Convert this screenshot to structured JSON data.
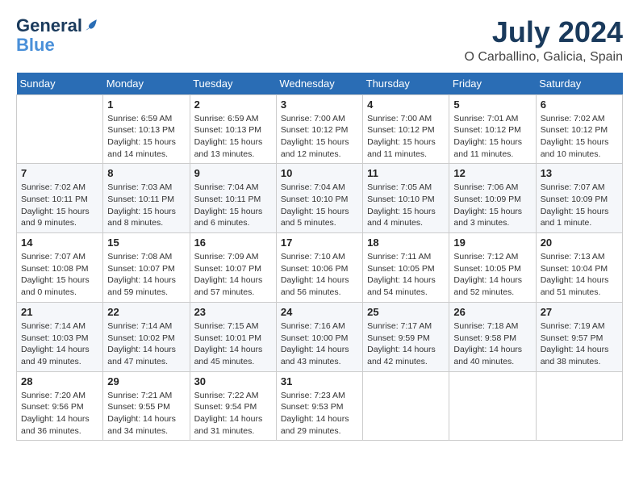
{
  "header": {
    "logo_line1": "General",
    "logo_line2": "Blue",
    "month_year": "July 2024",
    "location": "O Carballino, Galicia, Spain"
  },
  "weekdays": [
    "Sunday",
    "Monday",
    "Tuesday",
    "Wednesday",
    "Thursday",
    "Friday",
    "Saturday"
  ],
  "weeks": [
    [
      {
        "day": "",
        "info": ""
      },
      {
        "day": "1",
        "info": "Sunrise: 6:59 AM\nSunset: 10:13 PM\nDaylight: 15 hours\nand 14 minutes."
      },
      {
        "day": "2",
        "info": "Sunrise: 6:59 AM\nSunset: 10:13 PM\nDaylight: 15 hours\nand 13 minutes."
      },
      {
        "day": "3",
        "info": "Sunrise: 7:00 AM\nSunset: 10:12 PM\nDaylight: 15 hours\nand 12 minutes."
      },
      {
        "day": "4",
        "info": "Sunrise: 7:00 AM\nSunset: 10:12 PM\nDaylight: 15 hours\nand 11 minutes."
      },
      {
        "day": "5",
        "info": "Sunrise: 7:01 AM\nSunset: 10:12 PM\nDaylight: 15 hours\nand 11 minutes."
      },
      {
        "day": "6",
        "info": "Sunrise: 7:02 AM\nSunset: 10:12 PM\nDaylight: 15 hours\nand 10 minutes."
      }
    ],
    [
      {
        "day": "7",
        "info": "Sunrise: 7:02 AM\nSunset: 10:11 PM\nDaylight: 15 hours\nand 9 minutes."
      },
      {
        "day": "8",
        "info": "Sunrise: 7:03 AM\nSunset: 10:11 PM\nDaylight: 15 hours\nand 8 minutes."
      },
      {
        "day": "9",
        "info": "Sunrise: 7:04 AM\nSunset: 10:11 PM\nDaylight: 15 hours\nand 6 minutes."
      },
      {
        "day": "10",
        "info": "Sunrise: 7:04 AM\nSunset: 10:10 PM\nDaylight: 15 hours\nand 5 minutes."
      },
      {
        "day": "11",
        "info": "Sunrise: 7:05 AM\nSunset: 10:10 PM\nDaylight: 15 hours\nand 4 minutes."
      },
      {
        "day": "12",
        "info": "Sunrise: 7:06 AM\nSunset: 10:09 PM\nDaylight: 15 hours\nand 3 minutes."
      },
      {
        "day": "13",
        "info": "Sunrise: 7:07 AM\nSunset: 10:09 PM\nDaylight: 15 hours\nand 1 minute."
      }
    ],
    [
      {
        "day": "14",
        "info": "Sunrise: 7:07 AM\nSunset: 10:08 PM\nDaylight: 15 hours\nand 0 minutes."
      },
      {
        "day": "15",
        "info": "Sunrise: 7:08 AM\nSunset: 10:07 PM\nDaylight: 14 hours\nand 59 minutes."
      },
      {
        "day": "16",
        "info": "Sunrise: 7:09 AM\nSunset: 10:07 PM\nDaylight: 14 hours\nand 57 minutes."
      },
      {
        "day": "17",
        "info": "Sunrise: 7:10 AM\nSunset: 10:06 PM\nDaylight: 14 hours\nand 56 minutes."
      },
      {
        "day": "18",
        "info": "Sunrise: 7:11 AM\nSunset: 10:05 PM\nDaylight: 14 hours\nand 54 minutes."
      },
      {
        "day": "19",
        "info": "Sunrise: 7:12 AM\nSunset: 10:05 PM\nDaylight: 14 hours\nand 52 minutes."
      },
      {
        "day": "20",
        "info": "Sunrise: 7:13 AM\nSunset: 10:04 PM\nDaylight: 14 hours\nand 51 minutes."
      }
    ],
    [
      {
        "day": "21",
        "info": "Sunrise: 7:14 AM\nSunset: 10:03 PM\nDaylight: 14 hours\nand 49 minutes."
      },
      {
        "day": "22",
        "info": "Sunrise: 7:14 AM\nSunset: 10:02 PM\nDaylight: 14 hours\nand 47 minutes."
      },
      {
        "day": "23",
        "info": "Sunrise: 7:15 AM\nSunset: 10:01 PM\nDaylight: 14 hours\nand 45 minutes."
      },
      {
        "day": "24",
        "info": "Sunrise: 7:16 AM\nSunset: 10:00 PM\nDaylight: 14 hours\nand 43 minutes."
      },
      {
        "day": "25",
        "info": "Sunrise: 7:17 AM\nSunset: 9:59 PM\nDaylight: 14 hours\nand 42 minutes."
      },
      {
        "day": "26",
        "info": "Sunrise: 7:18 AM\nSunset: 9:58 PM\nDaylight: 14 hours\nand 40 minutes."
      },
      {
        "day": "27",
        "info": "Sunrise: 7:19 AM\nSunset: 9:57 PM\nDaylight: 14 hours\nand 38 minutes."
      }
    ],
    [
      {
        "day": "28",
        "info": "Sunrise: 7:20 AM\nSunset: 9:56 PM\nDaylight: 14 hours\nand 36 minutes."
      },
      {
        "day": "29",
        "info": "Sunrise: 7:21 AM\nSunset: 9:55 PM\nDaylight: 14 hours\nand 34 minutes."
      },
      {
        "day": "30",
        "info": "Sunrise: 7:22 AM\nSunset: 9:54 PM\nDaylight: 14 hours\nand 31 minutes."
      },
      {
        "day": "31",
        "info": "Sunrise: 7:23 AM\nSunset: 9:53 PM\nDaylight: 14 hours\nand 29 minutes."
      },
      {
        "day": "",
        "info": ""
      },
      {
        "day": "",
        "info": ""
      },
      {
        "day": "",
        "info": ""
      }
    ]
  ]
}
